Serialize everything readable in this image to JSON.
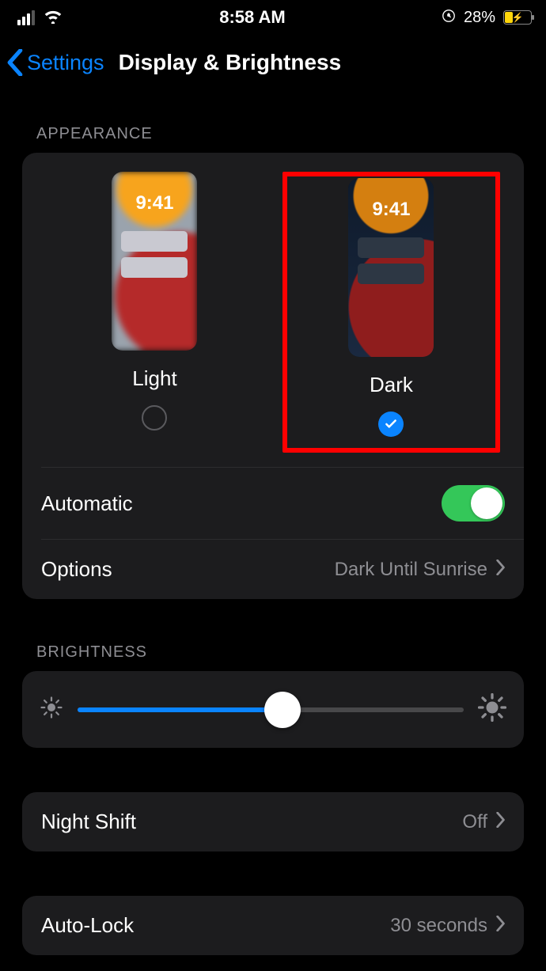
{
  "status": {
    "time": "8:58 AM",
    "battery_pct": "28%"
  },
  "nav": {
    "back_label": "Settings",
    "title": "Display & Brightness"
  },
  "appearance": {
    "header": "APPEARANCE",
    "light_label": "Light",
    "dark_label": "Dark",
    "thumb_time": "9:41",
    "selected": "dark",
    "automatic_label": "Automatic",
    "automatic_on": true,
    "options_label": "Options",
    "options_value": "Dark Until Sunrise"
  },
  "brightness": {
    "header": "BRIGHTNESS",
    "value_pct": 53
  },
  "night_shift": {
    "label": "Night Shift",
    "value": "Off"
  },
  "auto_lock": {
    "label": "Auto-Lock",
    "value": "30 seconds"
  }
}
